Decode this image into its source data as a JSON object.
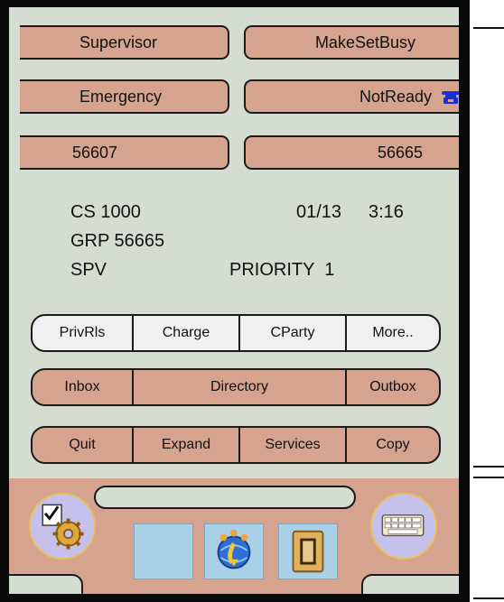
{
  "keys": {
    "supervisor": "Supervisor",
    "make_set_busy": "MakeSetBusy",
    "emergency": "Emergency",
    "not_ready": "NotReady",
    "dn_left": "56607",
    "dn_right": "56665"
  },
  "display": {
    "system": "CS 1000",
    "date": "01/13",
    "time": "3:16",
    "group": "GRP 56665",
    "role": "SPV",
    "priority": "PRIORITY  1"
  },
  "softkeys": [
    "PrivRls",
    "Charge",
    "CParty",
    "More.."
  ],
  "nav": {
    "inbox": "Inbox",
    "directory": "Directory",
    "outbox": "Outbox"
  },
  "actions": [
    "Quit",
    "Expand",
    "Services",
    "Copy"
  ],
  "dock": {
    "left_icon": "checklist-gear-icon",
    "right_icon": "keyboard-icon",
    "tiles": [
      "blank-tile",
      "network-user-icon",
      "phone-handset-icon"
    ]
  },
  "colors": {
    "key_tan": "#d6a48e",
    "screen_bg": "#d5ddd2",
    "accent_blue": "#1a2fd6"
  }
}
